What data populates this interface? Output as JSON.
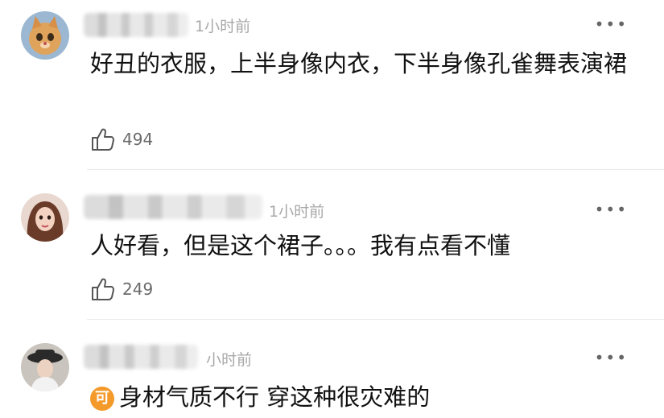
{
  "comments": [
    {
      "time": "1小时前",
      "text": "好丑的衣服，上半身像内衣，下半身像孔雀舞表演裙",
      "likes": "494",
      "more_icon": "ellipsis-icon"
    },
    {
      "time": "1小时前",
      "text": "人好看，但是这个裙子。。。我有点看不懂",
      "likes": "249",
      "more_icon": "ellipsis-icon"
    },
    {
      "time": "小时前",
      "badge": "可",
      "text": "身材气质不行 穿这种很灾难的",
      "more_icon": "ellipsis-icon"
    }
  ],
  "colors": {
    "time": "#a8a8a8",
    "text": "#111111",
    "like": "#6a6a6a",
    "badge": "#f39a2b",
    "divider": "#ebebeb"
  }
}
